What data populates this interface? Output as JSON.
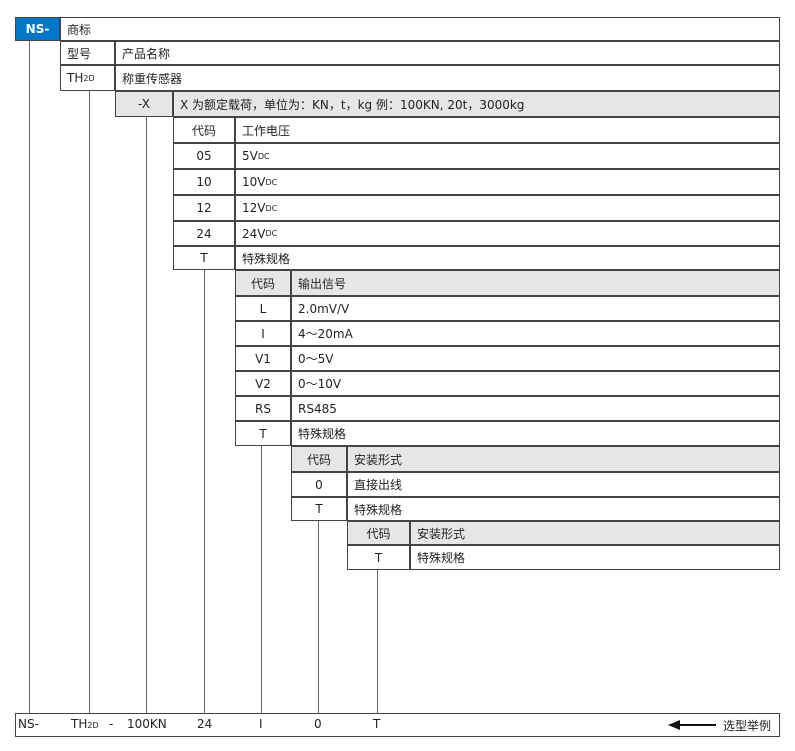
{
  "header": {
    "brand": "NS-",
    "label": "商标"
  },
  "model": {
    "label": "型号",
    "name_label": "产品名称",
    "code": "TH",
    "code_sub": "2D",
    "name": "称重传感器"
  },
  "capacity": {
    "code": "-X",
    "desc": "X 为额定载荷，单位为：KN，t，kg 例：100KN, 20t，3000kg"
  },
  "voltage": {
    "header_code": "代码",
    "header_desc": "工作电压",
    "rows": [
      {
        "code": "05",
        "value": "5V",
        "sub": "DC"
      },
      {
        "code": "10",
        "value": "10V",
        "sub": "DC"
      },
      {
        "code": "12",
        "value": "12V",
        "sub": "DC"
      },
      {
        "code": "24",
        "value": "24V",
        "sub": "DC"
      },
      {
        "code": "T",
        "value": "特殊规格",
        "sub": ""
      }
    ]
  },
  "output": {
    "header_code": "代码",
    "header_desc": "输出信号",
    "rows": [
      {
        "code": "L",
        "value": "2.0mV/V"
      },
      {
        "code": "I",
        "value": "4～20mA"
      },
      {
        "code": "V1",
        "value": "0～5V"
      },
      {
        "code": "V2",
        "value": "0～10V"
      },
      {
        "code": "RS",
        "value": "RS485"
      },
      {
        "code": "T",
        "value": "特殊规格"
      }
    ]
  },
  "install": {
    "header_code": "代码",
    "header_desc": "安装形式",
    "rows": [
      {
        "code": "0",
        "value": "直接出线"
      },
      {
        "code": "T",
        "value": "特殊规格"
      }
    ]
  },
  "install2": {
    "header_code": "代码",
    "header_desc": "安装形式",
    "rows": [
      {
        "code": "T",
        "value": "特殊规格"
      }
    ]
  },
  "example": {
    "brand": "NS-",
    "model": "TH",
    "model_sub": "2D",
    "dash": "-",
    "capacity": "100KN",
    "voltage": "24",
    "output": "I",
    "install": "0",
    "install2": "T",
    "label": "选型举例"
  }
}
